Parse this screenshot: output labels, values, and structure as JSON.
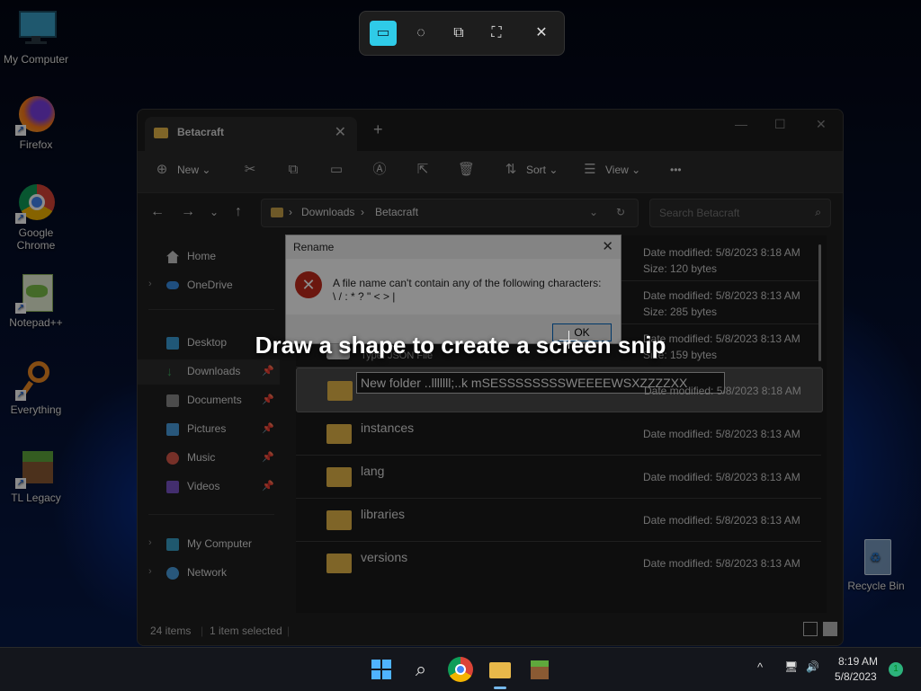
{
  "desktop": {
    "icons": [
      {
        "label": "My Computer",
        "icon": "monitor-icon"
      },
      {
        "label": "Firefox",
        "icon": "firefox-icon"
      },
      {
        "label": "Google Chrome",
        "icon": "chrome-icon"
      },
      {
        "label": "Notepad++",
        "icon": "notepad-plus-plus-icon"
      },
      {
        "label": "Everything",
        "icon": "magnifier-icon"
      },
      {
        "label": "TL Legacy",
        "icon": "minecraft-block-icon"
      },
      {
        "label": "Recycle Bin",
        "icon": "recycle-bin-icon"
      }
    ]
  },
  "snip": {
    "banner": "Draw a shape to create a screen snip",
    "modes": [
      "rectangle-snip-icon",
      "freeform-snip-icon",
      "window-snip-icon",
      "fullscreen-snip-icon",
      "close-icon"
    ]
  },
  "explorer": {
    "tab_title": "Betacraft",
    "toolbar": {
      "new": "New",
      "sort": "Sort",
      "view": "View",
      "more": "•••"
    },
    "breadcrumb": {
      "sep": "›",
      "parent": "Downloads",
      "current": "Betacraft"
    },
    "search_placeholder": "Search Betacraft",
    "sidebar": {
      "home": "Home",
      "onedrive": "OneDrive",
      "desktop": "Desktop",
      "downloads": "Downloads",
      "documents": "Documents",
      "pictures": "Pictures",
      "music": "Music",
      "videos": "Videos",
      "my_computer": "My Computer",
      "network": "Network"
    },
    "files": [
      {
        "name": "",
        "type": "",
        "date": "Date modified: 5/8/2023 8:18 AM",
        "size": "Size: 120 bytes"
      },
      {
        "name": "",
        "type": "",
        "date": "Date modified: 5/8/2023 8:13 AM",
        "size": "Size: 285 bytes"
      },
      {
        "name": "settings",
        "type": "Type: JSON File",
        "date": "Date modified: 5/8/2023 8:13 AM",
        "size": "Size: 159 bytes"
      },
      {
        "name": "New folder ..lllllll;..k  mSESSSSSSSSWEEEEWSXZZZZXX",
        "date": "Date modified: 5/8/2023 8:18 AM"
      },
      {
        "name": "instances",
        "date": "Date modified: 5/8/2023 8:13 AM"
      },
      {
        "name": "lang",
        "date": "Date modified: 5/8/2023 8:13 AM"
      },
      {
        "name": "libraries",
        "date": "Date modified: 5/8/2023 8:13 AM"
      },
      {
        "name": "versions",
        "date": "Date modified: 5/8/2023 8:13 AM"
      }
    ],
    "status": {
      "count": "24 items",
      "selected": "1 item selected"
    }
  },
  "dialog": {
    "title": "Rename",
    "message1": "A file name can't contain any of the following characters:",
    "message2": "\\ / : * ? \" < > |",
    "ok": "OK"
  },
  "taskbar": {
    "time": "8:19 AM",
    "date": "5/8/2023",
    "badge": "1"
  }
}
